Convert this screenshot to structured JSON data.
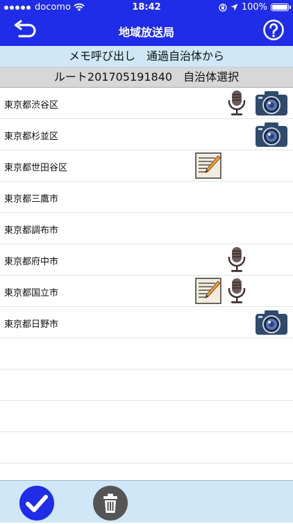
{
  "status_bar": {
    "carrier": "docomo",
    "time": "18:42",
    "battery": "100%",
    "icons": [
      "signal-dots-icon",
      "wifi-icon",
      "orientation-lock-icon",
      "location-arrow-icon",
      "battery-icon"
    ]
  },
  "nav": {
    "title": "地域放送局",
    "back_icon": "back-arrow-icon",
    "help_icon": "help-icon"
  },
  "header": {
    "subtitle": "メモ呼び出し　通過自治体から",
    "route_label": "ルート201705191840　自治体選択"
  },
  "municipalities": [
    {
      "name": "東京都渋谷区",
      "memo": false,
      "voice": true,
      "photo": true
    },
    {
      "name": "東京都杉並区",
      "memo": false,
      "voice": false,
      "photo": true
    },
    {
      "name": "東京都世田谷区",
      "memo": true,
      "voice": false,
      "photo": false
    },
    {
      "name": "東京都三鷹市",
      "memo": false,
      "voice": false,
      "photo": false
    },
    {
      "name": "東京都調布市",
      "memo": false,
      "voice": false,
      "photo": false
    },
    {
      "name": "東京都府中市",
      "memo": false,
      "voice": true,
      "photo": false
    },
    {
      "name": "東京都国立市",
      "memo": true,
      "voice": true,
      "photo": false
    },
    {
      "name": "東京都日野市",
      "memo": false,
      "voice": false,
      "photo": true
    },
    {
      "name": "",
      "memo": false,
      "voice": false,
      "photo": false
    },
    {
      "name": "",
      "memo": false,
      "voice": false,
      "photo": false
    },
    {
      "name": "",
      "memo": false,
      "voice": false,
      "photo": false
    },
    {
      "name": "",
      "memo": false,
      "voice": false,
      "photo": false
    },
    {
      "name": "",
      "memo": false,
      "voice": false,
      "photo": false
    }
  ],
  "toolbar": {
    "confirm_icon": "checkmark-icon",
    "delete_icon": "trash-icon"
  },
  "colors": {
    "nav_blue": "#1f2ce8",
    "light_band": "#cfe7f7",
    "gray_band": "#d7d7d7",
    "confirm_blue": "#1f2ce8",
    "trash_gray": "#555555"
  }
}
